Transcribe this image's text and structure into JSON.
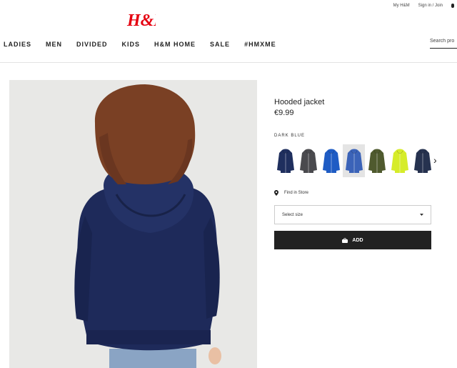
{
  "top_links": {
    "my_hm": "My H&M",
    "sign_in": "Sign in / Join"
  },
  "logo_text": "H&M",
  "nav": [
    "LADIES",
    "MEN",
    "DIVIDED",
    "KIDS",
    "H&M HOME",
    "SALE",
    "#HMXME"
  ],
  "search": {
    "placeholder": "Search pro"
  },
  "product": {
    "title": "Hooded jacket",
    "price": "€9.99",
    "color_label": "DARK BLUE",
    "swatches": [
      {
        "color": "#1f2f5e",
        "selected": false
      },
      {
        "color": "#4a4a4e",
        "selected": false
      },
      {
        "color": "#1f5cc4",
        "selected": false
      },
      {
        "color": "#3b63b8",
        "selected": true
      },
      {
        "color": "#4f5a2e",
        "selected": false
      },
      {
        "color": "#d6ec2a",
        "selected": false
      },
      {
        "color": "#26324f",
        "selected": false
      }
    ],
    "find_in_store": "Find in Store",
    "select_size": "Select size",
    "add_label": "ADD"
  },
  "colors": {
    "brand_red": "#e50010",
    "hoodie_navy": "#1e2a5a",
    "hair": "#7a4024"
  }
}
